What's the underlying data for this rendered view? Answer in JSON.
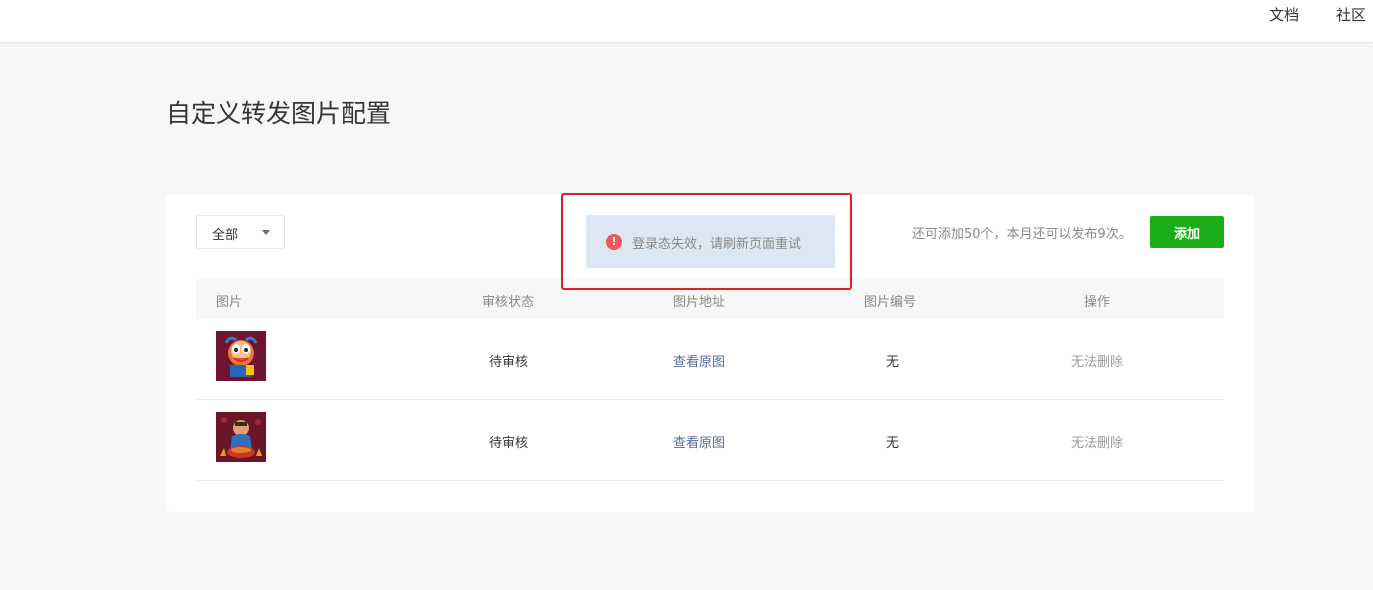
{
  "topnav": {
    "docs": "文档",
    "community": "社区"
  },
  "page": {
    "title": "自定义转发图片配置"
  },
  "toolbar": {
    "filter_value": "全部",
    "quota_text": "还可添加50个，本月还可以发布9次。",
    "add_label": "添加"
  },
  "table": {
    "headers": {
      "image": "图片",
      "status": "审核状态",
      "url": "图片地址",
      "id": "图片编号",
      "ops": "操作"
    },
    "rows": [
      {
        "status": "待审核",
        "url_label": "查看原图",
        "id": "无",
        "op": "无法删除"
      },
      {
        "status": "待审核",
        "url_label": "查看原图",
        "id": "无",
        "op": "无法删除"
      }
    ]
  },
  "toast": {
    "message": "登录态失效，请刷新页面重试"
  },
  "colors": {
    "primary_green": "#1aad19",
    "link_blue": "#576b95",
    "warn_red": "#f25858",
    "highlight_red": "#e02020"
  }
}
